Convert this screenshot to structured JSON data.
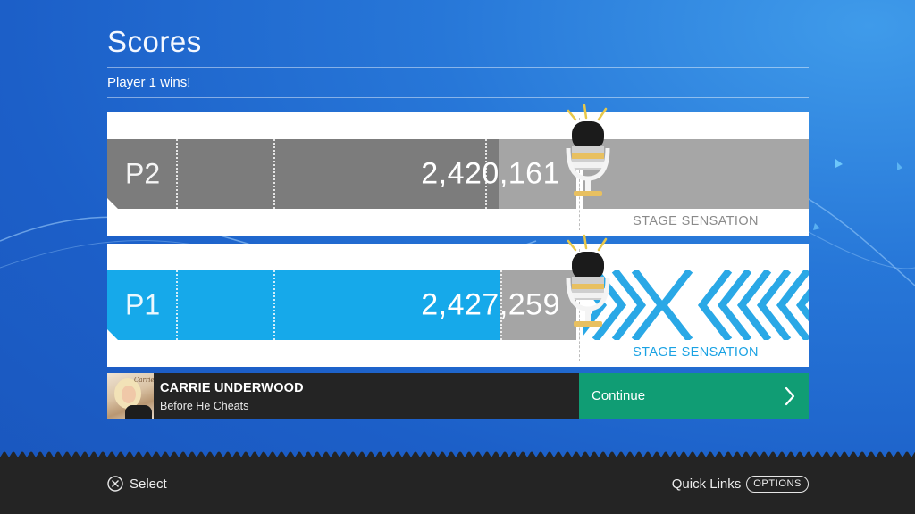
{
  "header": {
    "title": "Scores",
    "result": "Player 1 wins!"
  },
  "players": [
    {
      "label": "P2",
      "score": "2,420,161",
      "score_fraction": 0.835,
      "award": "STAGE SENSATION",
      "bar_color": "#7c7c7c"
    },
    {
      "label": "P1",
      "score": "2,427,259",
      "score_fraction": 0.838,
      "award": "STAGE SENSATION",
      "bar_color": "#16a9ea"
    }
  ],
  "song": {
    "artist": "CARRIE UNDERWOOD",
    "title": "Before He Cheats",
    "album_script": "Carrie"
  },
  "actions": {
    "continue_label": "Continue"
  },
  "footer": {
    "select_label": "Select",
    "quick_links_label": "Quick Links",
    "options_label": "OPTIONS"
  },
  "colors": {
    "background": "#1f63cc",
    "p1_accent": "#16a9ea",
    "p2_accent": "#7c7c7c",
    "continue": "#109d74",
    "bottom_bar": "#242424"
  }
}
